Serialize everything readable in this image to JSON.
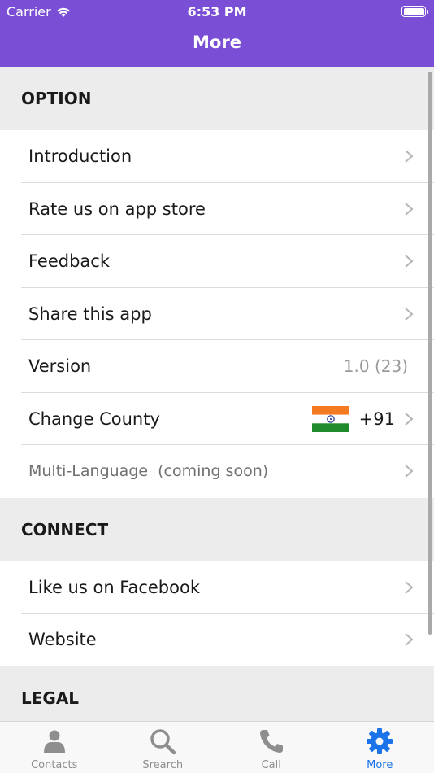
{
  "status": {
    "carrier": "Carrier",
    "time": "6:53 PM"
  },
  "nav": {
    "title": "More"
  },
  "sections": {
    "option": {
      "header": "OPTION"
    },
    "connect": {
      "header": "CONNECT"
    },
    "legal": {
      "header": "LEGAL"
    }
  },
  "rows": {
    "introduction": "Introduction",
    "rate": "Rate us on app store",
    "feedback": "Feedback",
    "share": "Share this app",
    "version_label": "Version",
    "version_value": "1.0 (23)",
    "country_label": "Change County",
    "country_code": "+91",
    "language": "Multi-Language  (coming soon)",
    "facebook": "Like us on Facebook",
    "website": "Website"
  },
  "tabs": {
    "contacts": "Contacts",
    "search": "Srearch",
    "call": "Call",
    "more": "More"
  },
  "colors": {
    "nav_bg": "#7a4fd6",
    "active_tab": "#1a73e8",
    "section_bg": "#ececec"
  }
}
